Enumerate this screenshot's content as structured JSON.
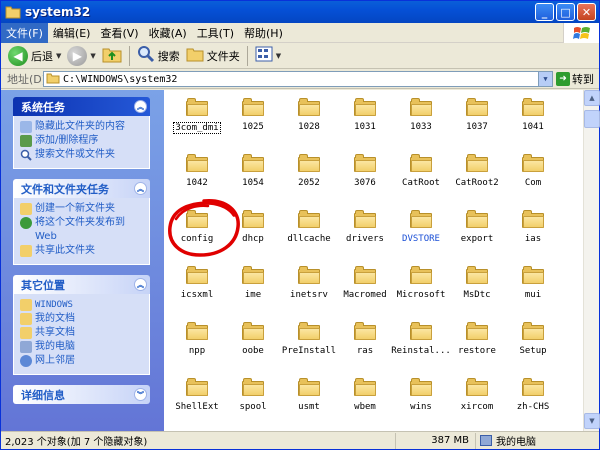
{
  "window": {
    "title": "system32"
  },
  "menu": [
    "文件(F)",
    "编辑(E)",
    "查看(V)",
    "收藏(A)",
    "工具(T)",
    "帮助(H)"
  ],
  "toolbar": {
    "back_label": "后退",
    "search_label": "搜索",
    "folders_label": "文件夹"
  },
  "address": {
    "label": "地址(D)",
    "path": "C:\\WINDOWS\\system32",
    "go_label": "转到"
  },
  "tasks_panel": {
    "title": "系统任务",
    "items": [
      "隐藏此文件夹的内容",
      "添加/删除程序",
      "搜索文件或文件夹"
    ]
  },
  "file_tasks_panel": {
    "title": "文件和文件夹任务",
    "items": [
      "创建一个新文件夹",
      "将这个文件夹发布到 Web",
      "共享此文件夹"
    ]
  },
  "other_places_panel": {
    "title": "其它位置",
    "items": [
      "WINDOWS",
      "我的文档",
      "共享文档",
      "我的电脑",
      "网上邻居"
    ]
  },
  "details_panel": {
    "title": "详细信息"
  },
  "folders": [
    "3com_dmi",
    "1025",
    "1028",
    "1031",
    "1033",
    "1037",
    "1041",
    "1042",
    "1054",
    "2052",
    "3076",
    "CatRoot",
    "CatRoot2",
    "Com",
    "config",
    "dhcp",
    "dllcache",
    "drivers",
    "DVSTORE",
    "export",
    "ias",
    "icsxml",
    "ime",
    "inetsrv",
    "Macromed",
    "Microsoft",
    "MsDtc",
    "mui",
    "npp",
    "oobe",
    "PreInstall",
    "ras",
    "Reinstal...",
    "restore",
    "Setup",
    "ShellExt",
    "spool",
    "usmt",
    "wbem",
    "wins",
    "xircom",
    "zh-CHS"
  ],
  "status": {
    "count": "2,023 个对象(加 7 个隐藏对象)",
    "size": "387 MB",
    "location": "我的电脑"
  },
  "colors": {
    "title_bar": "#0550d6",
    "task_pane": "#7ba2e7",
    "highlight_circle": "#e00000"
  }
}
